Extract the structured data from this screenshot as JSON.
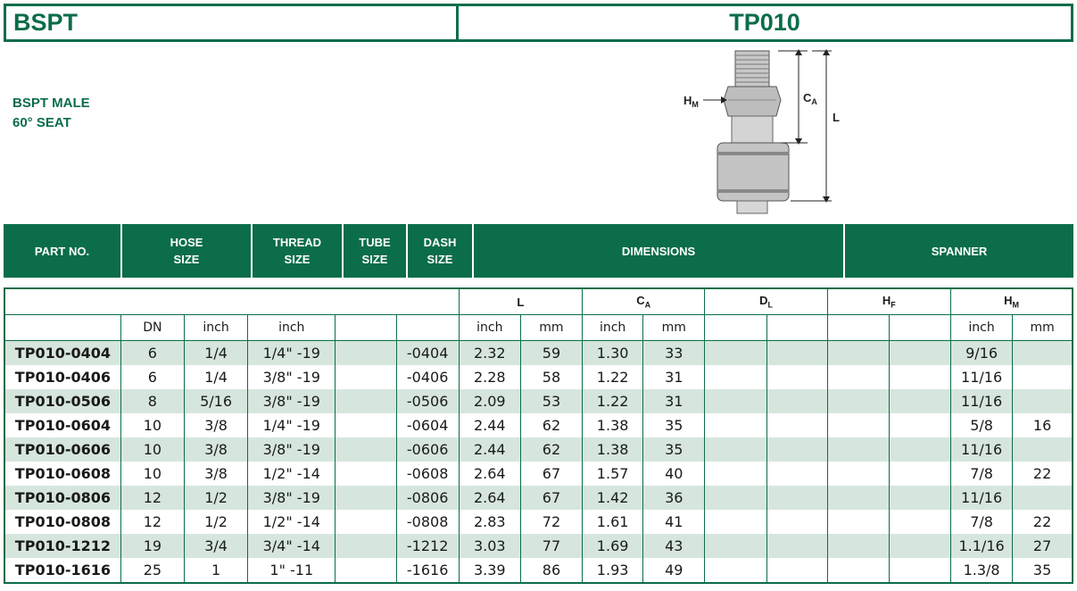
{
  "header": {
    "left_title": "BSPT",
    "right_title": "TP010"
  },
  "description": {
    "line1": "BSPT MALE",
    "line2": "60° SEAT"
  },
  "diagram": {
    "labels": {
      "hm": "H",
      "hm_sub": "M",
      "ca": "C",
      "ca_sub": "A",
      "l": "L"
    }
  },
  "columns": {
    "part_no": "PART NO.",
    "hose_size": [
      "HOSE",
      "SIZE"
    ],
    "thread_size": [
      "THREAD",
      "SIZE"
    ],
    "tube_size": [
      "TUBE",
      "SIZE"
    ],
    "dash_size": [
      "DASH",
      "SIZE"
    ],
    "dimensions": "DIMENSIONS",
    "spanner": "SPANNER"
  },
  "groups": {
    "l": "L",
    "ca": "C",
    "ca_sub": "A",
    "dl": "D",
    "dl_sub": "L",
    "hf": "H",
    "hf_sub": "F",
    "hm": "H",
    "hm_sub": "M"
  },
  "units": {
    "dn": "DN",
    "hose_inch": "inch",
    "thread_inch": "inch",
    "l_inch": "inch",
    "l_mm": "mm",
    "ca_inch": "inch",
    "ca_mm": "mm",
    "hm_inch": "inch",
    "hm_mm": "mm"
  },
  "rows": [
    {
      "part": "TP010-0404",
      "dn": "6",
      "inch": "1/4",
      "thread": "1/4\" -19",
      "tube": "",
      "dash": "-0404",
      "l_in": "2.32",
      "l_mm": "59",
      "ca_in": "1.30",
      "ca_mm": "33",
      "hm_in": "9/16",
      "hm_mm": ""
    },
    {
      "part": "TP010-0406",
      "dn": "6",
      "inch": "1/4",
      "thread": "3/8\" -19",
      "tube": "",
      "dash": "-0406",
      "l_in": "2.28",
      "l_mm": "58",
      "ca_in": "1.22",
      "ca_mm": "31",
      "hm_in": "11/16",
      "hm_mm": ""
    },
    {
      "part": "TP010-0506",
      "dn": "8",
      "inch": "5/16",
      "thread": "3/8\" -19",
      "tube": "",
      "dash": "-0506",
      "l_in": "2.09",
      "l_mm": "53",
      "ca_in": "1.22",
      "ca_mm": "31",
      "hm_in": "11/16",
      "hm_mm": ""
    },
    {
      "part": "TP010-0604",
      "dn": "10",
      "inch": "3/8",
      "thread": "1/4\" -19",
      "tube": "",
      "dash": "-0604",
      "l_in": "2.44",
      "l_mm": "62",
      "ca_in": "1.38",
      "ca_mm": "35",
      "hm_in": "5/8",
      "hm_mm": "16"
    },
    {
      "part": "TP010-0606",
      "dn": "10",
      "inch": "3/8",
      "thread": "3/8\" -19",
      "tube": "",
      "dash": "-0606",
      "l_in": "2.44",
      "l_mm": "62",
      "ca_in": "1.38",
      "ca_mm": "35",
      "hm_in": "11/16",
      "hm_mm": ""
    },
    {
      "part": "TP010-0608",
      "dn": "10",
      "inch": "3/8",
      "thread": "1/2\" -14",
      "tube": "",
      "dash": "-0608",
      "l_in": "2.64",
      "l_mm": "67",
      "ca_in": "1.57",
      "ca_mm": "40",
      "hm_in": "7/8",
      "hm_mm": "22"
    },
    {
      "part": "TP010-0806",
      "dn": "12",
      "inch": "1/2",
      "thread": "3/8\" -19",
      "tube": "",
      "dash": "-0806",
      "l_in": "2.64",
      "l_mm": "67",
      "ca_in": "1.42",
      "ca_mm": "36",
      "hm_in": "11/16",
      "hm_mm": ""
    },
    {
      "part": "TP010-0808",
      "dn": "12",
      "inch": "1/2",
      "thread": "1/2\" -14",
      "tube": "",
      "dash": "-0808",
      "l_in": "2.83",
      "l_mm": "72",
      "ca_in": "1.61",
      "ca_mm": "41",
      "hm_in": "7/8",
      "hm_mm": "22"
    },
    {
      "part": "TP010-1212",
      "dn": "19",
      "inch": "3/4",
      "thread": "3/4\" -14",
      "tube": "",
      "dash": "-1212",
      "l_in": "3.03",
      "l_mm": "77",
      "ca_in": "1.69",
      "ca_mm": "43",
      "hm_in": "1.1/16",
      "hm_mm": "27"
    },
    {
      "part": "TP010-1616",
      "dn": "25",
      "inch": "1",
      "thread": "1\" -11",
      "tube": "",
      "dash": "-1616",
      "l_in": "3.39",
      "l_mm": "86",
      "ca_in": "1.93",
      "ca_mm": "49",
      "hm_in": "1.3/8",
      "hm_mm": "35"
    }
  ]
}
